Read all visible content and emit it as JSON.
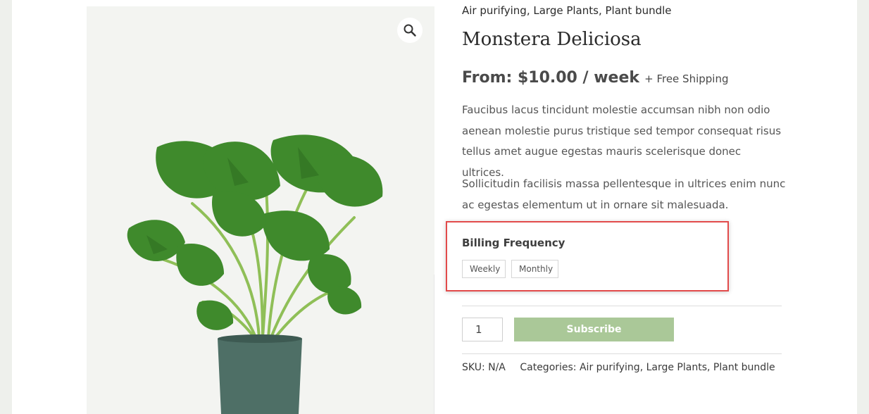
{
  "product": {
    "tags": [
      "Air purifying",
      "Large Plants",
      "Plant bundle"
    ],
    "title": "Monstera Deliciosa",
    "price": "From: $10.00 / week",
    "shipping": "+ Free Shipping",
    "description": [
      "Faucibus lacus tincidunt molestie accumsan nibh non odio aenean molestie purus tristique sed tempor consequat risus tellus amet augue egestas mauris scelerisque donec ultrices.",
      "Sollicitudin facilisis massa pellentesque in ultrices enim nunc ac egestas elementum ut in ornare sit malesuada."
    ]
  },
  "billing": {
    "label": "Billing Frequency",
    "options": [
      "Weekly",
      "Monthly"
    ]
  },
  "cart": {
    "quantity": "1",
    "subscribe_label": "Subscribe"
  },
  "meta": {
    "sku_label": "SKU:",
    "sku_value": "N/A",
    "categories_label": "Categories:",
    "categories": [
      "Air purifying",
      "Large Plants",
      "Plant bundle"
    ]
  },
  "icons": {
    "zoom": "magnifier-icon"
  },
  "colors": {
    "accent_button": "#aac898",
    "highlight_border": "#e24b4b",
    "gallery_bg": "#f3f4f1"
  }
}
